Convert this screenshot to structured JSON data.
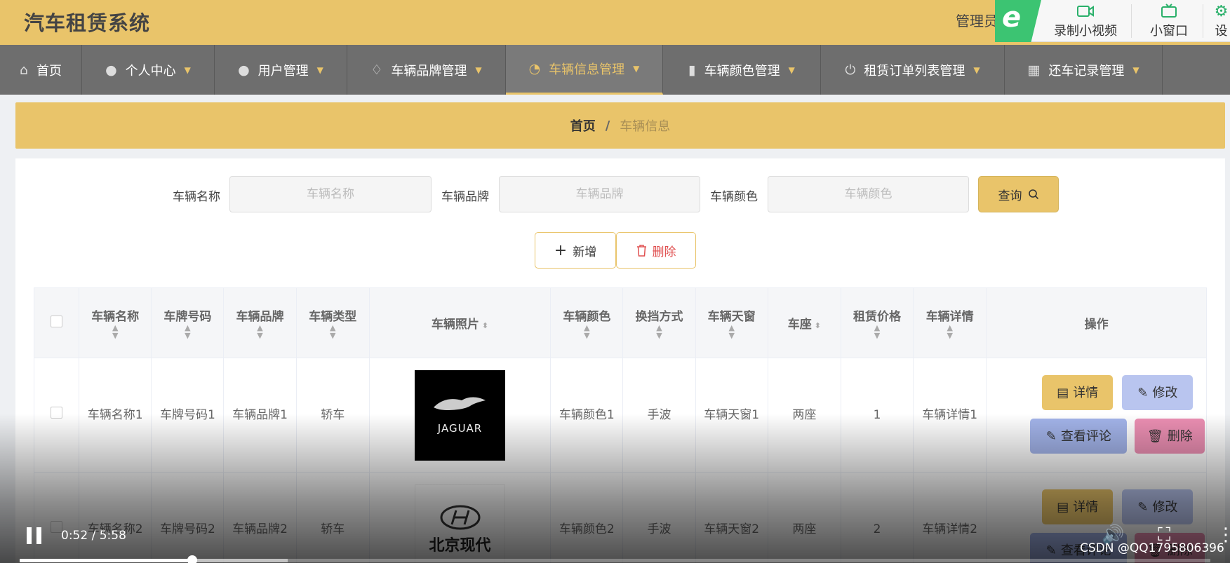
{
  "app": {
    "title": "汽车租赁系统",
    "admin_label": "管理员"
  },
  "recorder": {
    "record_label": "录制小视频",
    "mini_label": "小窗口",
    "settings_label": "设"
  },
  "nav": [
    {
      "label": "首页",
      "icon": "home-icon"
    },
    {
      "label": "个人中心",
      "icon": "user-icon"
    },
    {
      "label": "用户管理",
      "icon": "user-icon"
    },
    {
      "label": "车辆品牌管理",
      "icon": "bell-icon"
    },
    {
      "label": "车辆信息管理",
      "icon": "gauge-icon",
      "active": true
    },
    {
      "label": "车辆颜色管理",
      "icon": "bar-chart-icon"
    },
    {
      "label": "租赁订单列表管理",
      "icon": "power-icon"
    },
    {
      "label": "还车记录管理",
      "icon": "grid-icon"
    }
  ],
  "breadcrumb": {
    "home": "首页",
    "separator": "/",
    "current": "车辆信息"
  },
  "filters": {
    "name": {
      "label": "车辆名称",
      "placeholder": "车辆名称"
    },
    "brand": {
      "label": "车辆品牌",
      "placeholder": "车辆品牌"
    },
    "color": {
      "label": "车辆颜色",
      "placeholder": "车辆颜色"
    },
    "query_label": "查询"
  },
  "actions": {
    "add_label": "新增",
    "delete_label": "删除"
  },
  "table": {
    "headers": [
      "车辆名称",
      "车牌号码",
      "车辆品牌",
      "车辆类型",
      "车辆照片",
      "车辆颜色",
      "换挡方式",
      "车辆天窗",
      "车座",
      "租赁价格",
      "车辆详情",
      "操作"
    ],
    "rows": [
      {
        "name": "车辆名称1",
        "plate": "车牌号码1",
        "brand": "车辆品牌1",
        "type": "轿车",
        "photo": "JAGUAR",
        "color": "车辆颜色1",
        "gear": "手波",
        "sunroof": "车辆天窗1",
        "seats": "两座",
        "price": "1",
        "details": "车辆详情1"
      },
      {
        "name": "车辆名称2",
        "plate": "车牌号码2",
        "brand": "车辆品牌2",
        "type": "轿车",
        "photo": "北京现代",
        "color": "车辆颜色2",
        "gear": "手波",
        "sunroof": "车辆天窗2",
        "seats": "两座",
        "price": "2",
        "details": "车辆详情2"
      }
    ],
    "row_ops": {
      "detail": "详情",
      "edit": "修改",
      "review": "查看评论",
      "remove": "删除"
    }
  },
  "video": {
    "time": "0:52 / 5:58",
    "progress": 0.145
  },
  "watermark": "CSDN @QQ1795806396"
}
